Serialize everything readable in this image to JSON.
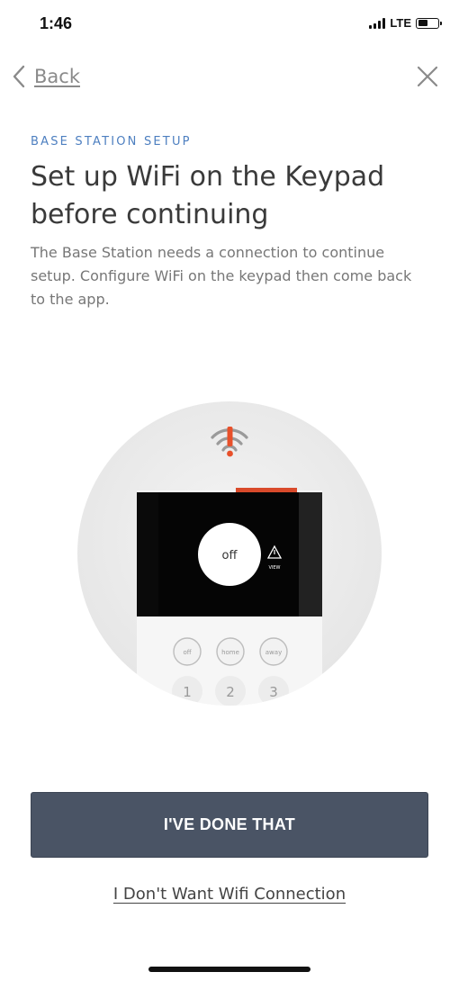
{
  "status_bar": {
    "time": "1:46",
    "network": "LTE",
    "battery_level": 0.5
  },
  "nav": {
    "back_label": "Back",
    "back_icon": "chevron-left-icon",
    "close_icon": "close-icon"
  },
  "content": {
    "eyebrow": "BASE STATION SETUP",
    "title": "Set up WiFi on the Keypad before continuing",
    "description": "The Base Station needs a connection to continue setup. Configure WiFi on the keypad then come back to the app."
  },
  "illustration": {
    "icon": "wifi-warning-icon",
    "screen_mode": "off",
    "screen_alert": "VIEW",
    "mode_buttons": [
      "off",
      "home",
      "away"
    ],
    "number_keys": [
      "1",
      "2",
      "3"
    ]
  },
  "actions": {
    "primary_label": "I'VE DONE THAT",
    "secondary_label": "I Don't Want Wifi Connection"
  },
  "colors": {
    "accent": "#4d7fc0",
    "primary_button": "#4a5465",
    "warning": "#e8502a"
  }
}
